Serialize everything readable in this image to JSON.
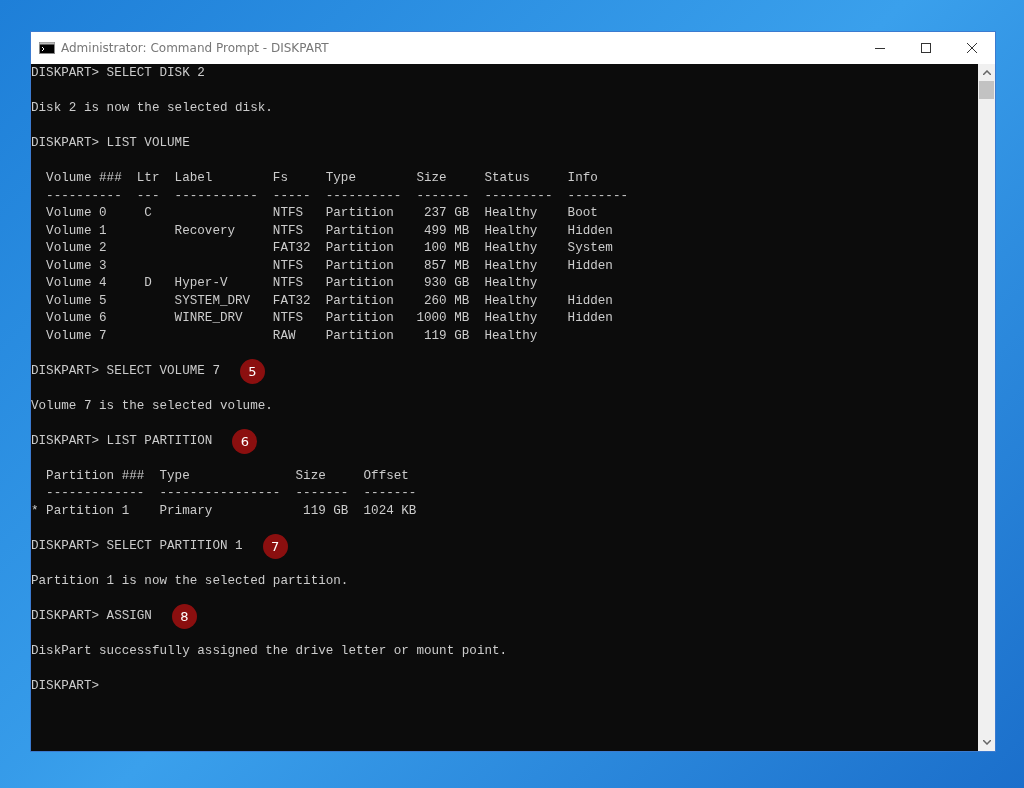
{
  "window": {
    "title": "Administrator: Command Prompt - DISKPART"
  },
  "console": {
    "blocks": [
      {
        "lines": [
          {
            "text": "DISKPART> SELECT DISK 2"
          }
        ]
      },
      {
        "lines": [
          {
            "text": "Disk 2 is now the selected disk."
          }
        ]
      },
      {
        "lines": [
          {
            "text": "DISKPART> LIST VOLUME"
          }
        ]
      },
      {
        "lines": [
          {
            "text": "  Volume ###  Ltr  Label        Fs     Type        Size     Status     Info"
          },
          {
            "text": "  ----------  ---  -----------  -----  ----------  -------  ---------  --------"
          },
          {
            "text": "  Volume 0     C                NTFS   Partition    237 GB  Healthy    Boot"
          },
          {
            "text": "  Volume 1         Recovery     NTFS   Partition    499 MB  Healthy    Hidden"
          },
          {
            "text": "  Volume 2                      FAT32  Partition    100 MB  Healthy    System"
          },
          {
            "text": "  Volume 3                      NTFS   Partition    857 MB  Healthy    Hidden"
          },
          {
            "text": "  Volume 4     D   Hyper-V      NTFS   Partition    930 GB  Healthy"
          },
          {
            "text": "  Volume 5         SYSTEM_DRV   FAT32  Partition    260 MB  Healthy    Hidden"
          },
          {
            "text": "  Volume 6         WINRE_DRV    NTFS   Partition   1000 MB  Healthy    Hidden"
          },
          {
            "text": "  Volume 7                      RAW    Partition    119 GB  Healthy"
          }
        ]
      },
      {
        "lines": [
          {
            "text": "DISKPART> SELECT VOLUME 7",
            "badge": "5"
          }
        ]
      },
      {
        "lines": [
          {
            "text": "Volume 7 is the selected volume."
          }
        ]
      },
      {
        "lines": [
          {
            "text": "DISKPART> LIST PARTITION",
            "badge": "6"
          }
        ]
      },
      {
        "lines": [
          {
            "text": "  Partition ###  Type              Size     Offset"
          },
          {
            "text": "  -------------  ----------------  -------  -------"
          },
          {
            "text": "* Partition 1    Primary            119 GB  1024 KB"
          }
        ]
      },
      {
        "lines": [
          {
            "text": "DISKPART> SELECT PARTITION 1",
            "badge": "7"
          }
        ]
      },
      {
        "lines": [
          {
            "text": "Partition 1 is now the selected partition."
          }
        ]
      },
      {
        "lines": [
          {
            "text": "DISKPART> ASSIGN",
            "badge": "8"
          }
        ]
      },
      {
        "lines": [
          {
            "text": "DiskPart successfully assigned the drive letter or mount point."
          }
        ]
      },
      {
        "lines": [
          {
            "text": "DISKPART>"
          }
        ]
      }
    ]
  }
}
